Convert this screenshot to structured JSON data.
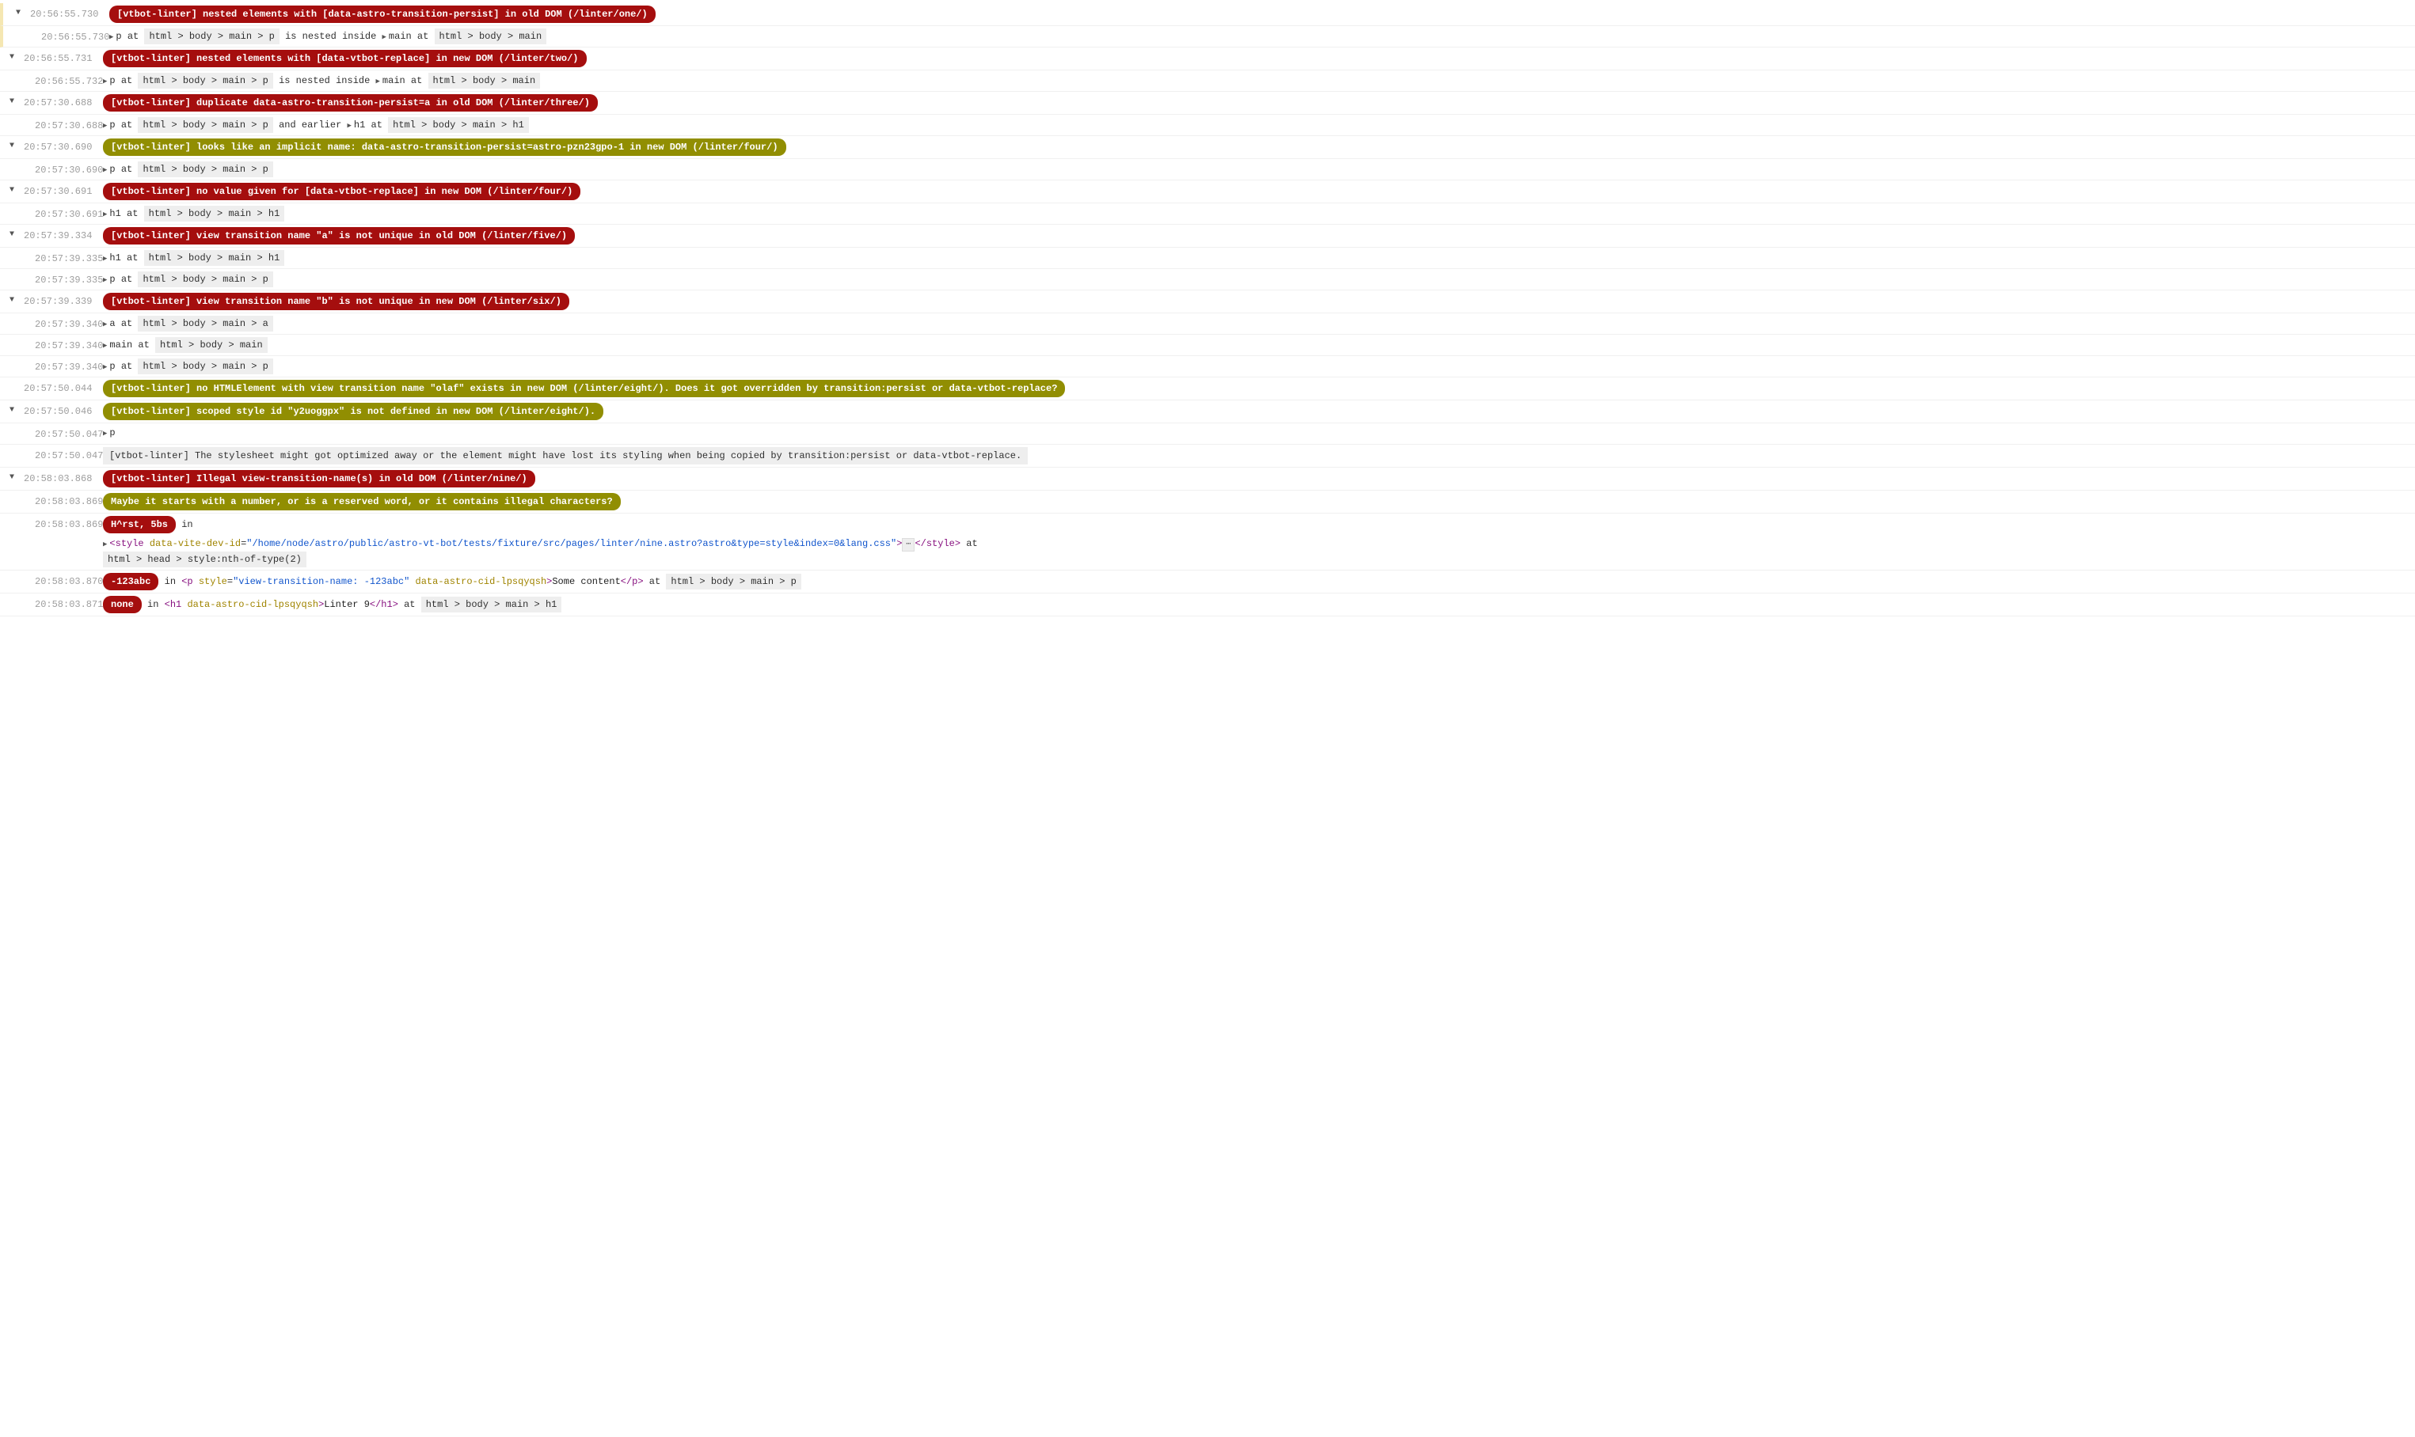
{
  "entries": [
    {
      "id": 0,
      "hasToggle": true,
      "hasBar": true,
      "time": "20:56:55.730",
      "pill": {
        "cls": "pill-red",
        "text": "[vtbot-linter] nested elements with [data-astro-transition-persist] in old DOM (/linter/one/)"
      }
    },
    {
      "id": 1,
      "hasToggle": false,
      "hasBar": true,
      "sub": true,
      "time": "20:56:55.730",
      "parts": [
        {
          "t": "arrow"
        },
        {
          "t": "text",
          "v": "p at "
        },
        {
          "t": "crumb",
          "v": "html > body > main > p"
        },
        {
          "t": "text",
          "v": " is nested inside "
        },
        {
          "t": "arrow"
        },
        {
          "t": "text",
          "v": "main at "
        },
        {
          "t": "crumb",
          "v": "html > body > main"
        }
      ]
    },
    {
      "id": 2,
      "hasToggle": true,
      "hasBar": false,
      "time": "20:56:55.731",
      "pill": {
        "cls": "pill-red",
        "text": "[vtbot-linter] nested elements with [data-vtbot-replace] in new DOM (/linter/two/)"
      }
    },
    {
      "id": 3,
      "hasToggle": false,
      "hasBar": false,
      "sub": true,
      "time": "20:56:55.732",
      "parts": [
        {
          "t": "arrow"
        },
        {
          "t": "text",
          "v": "p at "
        },
        {
          "t": "crumb",
          "v": "html > body > main > p"
        },
        {
          "t": "text",
          "v": " is nested inside "
        },
        {
          "t": "arrow"
        },
        {
          "t": "text",
          "v": "main at "
        },
        {
          "t": "crumb",
          "v": "html > body > main"
        }
      ]
    },
    {
      "id": 4,
      "hasToggle": true,
      "hasBar": false,
      "time": "20:57:30.688",
      "pill": {
        "cls": "pill-red",
        "text": "[vtbot-linter] duplicate data-astro-transition-persist=a in old DOM (/linter/three/)"
      }
    },
    {
      "id": 5,
      "hasToggle": false,
      "hasBar": false,
      "sub": true,
      "time": "20:57:30.688",
      "parts": [
        {
          "t": "arrow"
        },
        {
          "t": "text",
          "v": "p at "
        },
        {
          "t": "crumb",
          "v": "html > body > main > p"
        },
        {
          "t": "text",
          "v": " and earlier "
        },
        {
          "t": "arrow"
        },
        {
          "t": "text",
          "v": "h1 at "
        },
        {
          "t": "crumb",
          "v": "html > body > main > h1"
        }
      ]
    },
    {
      "id": 6,
      "hasToggle": true,
      "hasBar": false,
      "time": "20:57:30.690",
      "pill": {
        "cls": "pill-olive",
        "text": "[vtbot-linter] looks like an implicit name: data-astro-transition-persist=astro-pzn23gpo-1 in new DOM (/linter/four/)"
      }
    },
    {
      "id": 7,
      "hasToggle": false,
      "hasBar": false,
      "sub": true,
      "time": "20:57:30.690",
      "parts": [
        {
          "t": "arrow"
        },
        {
          "t": "text",
          "v": "p at "
        },
        {
          "t": "crumb",
          "v": "html > body > main > p"
        }
      ]
    },
    {
      "id": 8,
      "hasToggle": true,
      "hasBar": false,
      "time": "20:57:30.691",
      "pill": {
        "cls": "pill-red",
        "text": "[vtbot-linter] no value given for [data-vtbot-replace] in new DOM (/linter/four/)"
      }
    },
    {
      "id": 9,
      "hasToggle": false,
      "hasBar": false,
      "sub": true,
      "time": "20:57:30.691",
      "parts": [
        {
          "t": "arrow"
        },
        {
          "t": "text",
          "v": "h1 at "
        },
        {
          "t": "crumb",
          "v": "html > body > main > h1"
        }
      ]
    },
    {
      "id": 10,
      "hasToggle": true,
      "hasBar": false,
      "time": "20:57:39.334",
      "pill": {
        "cls": "pill-red",
        "text": "[vtbot-linter] view transition name \"a\" is not unique in old DOM (/linter/five/)"
      }
    },
    {
      "id": 11,
      "hasToggle": false,
      "hasBar": false,
      "sub": true,
      "time": "20:57:39.335",
      "parts": [
        {
          "t": "arrow"
        },
        {
          "t": "text",
          "v": "h1 at "
        },
        {
          "t": "crumb",
          "v": "html > body > main > h1"
        }
      ]
    },
    {
      "id": 12,
      "hasToggle": false,
      "hasBar": false,
      "sub": true,
      "time": "20:57:39.335",
      "parts": [
        {
          "t": "arrow"
        },
        {
          "t": "text",
          "v": "p at "
        },
        {
          "t": "crumb",
          "v": "html > body > main > p"
        }
      ]
    },
    {
      "id": 13,
      "hasToggle": true,
      "hasBar": false,
      "time": "20:57:39.339",
      "pill": {
        "cls": "pill-red",
        "text": "[vtbot-linter] view transition name \"b\" is not unique in new DOM (/linter/six/)"
      }
    },
    {
      "id": 14,
      "hasToggle": false,
      "hasBar": false,
      "sub": true,
      "time": "20:57:39.340",
      "parts": [
        {
          "t": "arrow"
        },
        {
          "t": "text",
          "v": "a at "
        },
        {
          "t": "crumb",
          "v": "html > body > main > a"
        }
      ]
    },
    {
      "id": 15,
      "hasToggle": false,
      "hasBar": false,
      "sub": true,
      "time": "20:57:39.340",
      "parts": [
        {
          "t": "arrow"
        },
        {
          "t": "text",
          "v": "main at "
        },
        {
          "t": "crumb",
          "v": "html > body > main"
        }
      ]
    },
    {
      "id": 16,
      "hasToggle": false,
      "hasBar": false,
      "sub": true,
      "time": "20:57:39.340",
      "parts": [
        {
          "t": "arrow"
        },
        {
          "t": "text",
          "v": "p at "
        },
        {
          "t": "crumb",
          "v": "html > body > main > p"
        }
      ]
    },
    {
      "id": 17,
      "hasToggle": false,
      "hasBar": false,
      "time": "20:57:50.044",
      "pill": {
        "cls": "pill-olive",
        "text": "[vtbot-linter] no HTMLElement with view transition name \"olaf\" exists in new DOM (/linter/eight/). Does it got overridden by transition:persist or data-vtbot-replace?"
      }
    },
    {
      "id": 18,
      "hasToggle": true,
      "hasBar": false,
      "time": "20:57:50.046",
      "pill": {
        "cls": "pill-olive",
        "text": "[vtbot-linter] scoped style id \"y2uoggpx\" is not defined in new DOM (/linter/eight/)."
      }
    },
    {
      "id": 19,
      "hasToggle": false,
      "hasBar": false,
      "sub": true,
      "time": "20:57:50.047",
      "parts": [
        {
          "t": "arrow"
        },
        {
          "t": "text",
          "v": "p"
        }
      ]
    },
    {
      "id": 20,
      "hasToggle": false,
      "hasBar": false,
      "sub": true,
      "time": "20:57:50.047",
      "plain": "[vtbot-linter] The stylesheet might got optimized away or the element might have lost its styling when being copied by transition:persist or data-vtbot-replace."
    },
    {
      "id": 21,
      "hasToggle": true,
      "hasBar": false,
      "time": "20:58:03.868",
      "pill": {
        "cls": "pill-red",
        "text": "[vtbot-linter] Illegal view-transition-name(s) in old DOM (/linter/nine/)"
      }
    },
    {
      "id": 22,
      "hasToggle": false,
      "hasBar": false,
      "sub": true,
      "time": "20:58:03.869",
      "pill": {
        "cls": "pill-olive",
        "text": "Maybe it starts with a number, or is a reserved word, or it contains illegal characters?"
      }
    },
    {
      "id": 23,
      "hasToggle": false,
      "hasBar": false,
      "sub": true,
      "time": "20:58:03.869",
      "parts": [
        {
          "t": "pill",
          "cls": "pill-red",
          "v": "H^rst, 5bs"
        },
        {
          "t": "text",
          "v": " in"
        }
      ],
      "html_line": {
        "pre_arrow": true,
        "segments": [
          {
            "t": "tag",
            "v": "<style "
          },
          {
            "t": "attr",
            "v": "data-vite-dev-id"
          },
          {
            "t": "eq",
            "v": "="
          },
          {
            "t": "val",
            "v": "\"/home/node/astro/public/astro-vt-bot/tests/fixture/src/pages/linter/nine.astro?astro&type=style&index=0&lang.css\""
          },
          {
            "t": "tag",
            "v": ">"
          },
          {
            "t": "ell"
          },
          {
            "t": "tag",
            "v": "</style>"
          },
          {
            "t": "text",
            "v": " at"
          }
        ],
        "crumb": "html > head > style:nth-of-type(2)"
      }
    },
    {
      "id": 24,
      "hasToggle": false,
      "hasBar": false,
      "sub": true,
      "time": "20:58:03.870",
      "parts": [
        {
          "t": "pill",
          "cls": "pill-red",
          "v": "-123abc"
        },
        {
          "t": "text",
          "v": " in   "
        },
        {
          "t": "html",
          "segments": [
            {
              "t": "tag",
              "v": "<p "
            },
            {
              "t": "attr",
              "v": "style"
            },
            {
              "t": "eq",
              "v": "="
            },
            {
              "t": "val",
              "v": "\"view-transition-name: -123abc\""
            },
            {
              "t": "tag",
              "v": " "
            },
            {
              "t": "attr",
              "v": "data-astro-cid-lpsqyqsh"
            },
            {
              "t": "tag",
              "v": ">"
            },
            {
              "t": "body",
              "v": "Some content"
            },
            {
              "t": "tag",
              "v": "</p>"
            }
          ]
        },
        {
          "t": "text",
          "v": " at "
        },
        {
          "t": "crumb",
          "v": "html > body > main > p"
        }
      ]
    },
    {
      "id": 25,
      "hasToggle": false,
      "hasBar": false,
      "sub": true,
      "time": "20:58:03.871",
      "parts": [
        {
          "t": "pill",
          "cls": "pill-red",
          "v": "none"
        },
        {
          "t": "text",
          "v": " in   "
        },
        {
          "t": "html",
          "segments": [
            {
              "t": "tag",
              "v": "<h1 "
            },
            {
              "t": "attr",
              "v": "data-astro-cid-lpsqyqsh"
            },
            {
              "t": "tag",
              "v": ">"
            },
            {
              "t": "body",
              "v": "Linter 9"
            },
            {
              "t": "tag",
              "v": "</h1>"
            }
          ]
        },
        {
          "t": "text",
          "v": " at "
        },
        {
          "t": "crumb",
          "v": "html > body > main > h1"
        }
      ]
    }
  ]
}
